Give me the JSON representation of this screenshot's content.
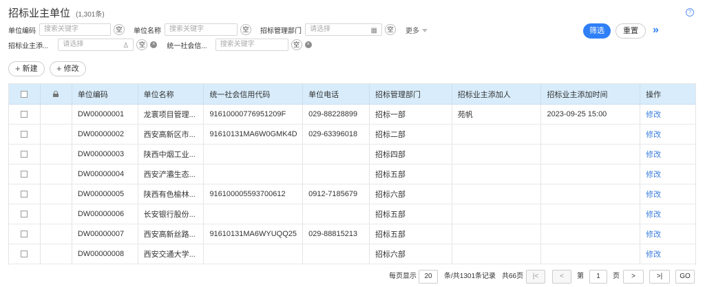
{
  "page": {
    "title": "招标业主单位",
    "count": "(1,301条)",
    "help": "?"
  },
  "filters": {
    "unit_code_label": "单位编码",
    "unit_code_placeholder": "搜索关键字",
    "unit_name_label": "单位名称",
    "unit_name_placeholder": "搜索关键字",
    "dept_label": "招标管理部门",
    "dept_placeholder": "请选择",
    "adder_label": "招标业主添...",
    "adder_placeholder": "请选择",
    "credit_label": "统一社会信...",
    "credit_placeholder": "搜索关键字",
    "empty_label": "空",
    "clear_label": "×",
    "more_label": "更多"
  },
  "actions": {
    "filter": "筛选",
    "reset": "重置",
    "expand": "»",
    "new": "新建",
    "edit": "修改",
    "plus": "+"
  },
  "icons": {
    "user": "user-icon",
    "table": "table-icon",
    "lock": "lock-icon",
    "checkbox": "checkbox-icon"
  },
  "table": {
    "columns": [
      "单位编码",
      "单位名称",
      "统一社会信用代码",
      "单位电话",
      "招标管理部门",
      "招标业主添加人",
      "招标业主添加时间",
      "操作"
    ],
    "rows": [
      {
        "code": "DW00000001",
        "name": "龙寰项目管理...",
        "credit": "91610000776951209F",
        "phone": "029-88228899",
        "dept": "招标一部",
        "adder": "苑帆",
        "time": "2023-09-25 15:00",
        "op": "修改"
      },
      {
        "code": "DW00000002",
        "name": "西安高新区市...",
        "credit": "91610131MA6W0GMK4D",
        "phone": "029-63396018",
        "dept": "招标二部",
        "adder": "",
        "time": "",
        "op": "修改"
      },
      {
        "code": "DW00000003",
        "name": "陕西中烟工业...",
        "credit": "",
        "phone": "",
        "dept": "招标四部",
        "adder": "",
        "time": "",
        "op": "修改"
      },
      {
        "code": "DW00000004",
        "name": "西安浐灞生态...",
        "credit": "",
        "phone": "",
        "dept": "招标五部",
        "adder": "",
        "time": "",
        "op": "修改"
      },
      {
        "code": "DW00000005",
        "name": "陕西有色榆林...",
        "credit": "916100005593700612",
        "phone": "0912-7185679",
        "dept": "招标六部",
        "adder": "",
        "time": "",
        "op": "修改"
      },
      {
        "code": "DW00000006",
        "name": "长安银行股份...",
        "credit": "",
        "phone": "",
        "dept": "招标五部",
        "adder": "",
        "time": "",
        "op": "修改"
      },
      {
        "code": "DW00000007",
        "name": "西安高新丝路...",
        "credit": "91610131MA6WYUQQ25",
        "phone": "029-88815213",
        "dept": "招标五部",
        "adder": "",
        "time": "",
        "op": "修改"
      },
      {
        "code": "DW00000008",
        "name": "西安交通大学...",
        "credit": "",
        "phone": "",
        "dept": "招标六部",
        "adder": "",
        "time": "",
        "op": "修改"
      }
    ]
  },
  "pager": {
    "per_page_label": "每页显示",
    "per_page": "20",
    "total_text": "条/共1301条记录",
    "pages_text": "共66页",
    "first": "|<",
    "prev": "<",
    "page_label": "第",
    "page": "1",
    "page_unit": "页",
    "next": ">",
    "last": ">|",
    "go": "GO"
  }
}
